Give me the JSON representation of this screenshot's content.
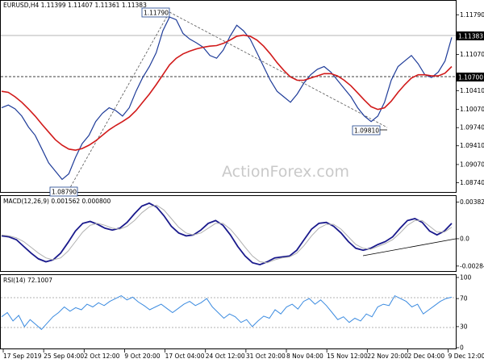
{
  "header": {
    "symbol_line": "EURUSD,H4  1.11399 1.11407 1.11361 1.11383",
    "macd_label": "MACD(12,26,9) 0.001562 0.000800",
    "rsi_label": "RSI(14) 72.1007",
    "watermark": "ActionForex.com"
  },
  "chart_data": [
    {
      "type": "line",
      "panel": "price",
      "y_ticks": [
        "1.11790",
        "1.11070",
        "1.10410",
        "1.10070",
        "1.09740",
        "1.09410",
        "1.09070",
        "1.08740"
      ],
      "y_range": [
        1.086,
        1.12
      ],
      "current_price": "1.11383",
      "horizontal_line_label": "1.10700",
      "annotations": [
        {
          "label": "1.11790",
          "value": 1.1179
        },
        {
          "label": "1.08790",
          "value": 1.0879
        },
        {
          "label": "1.09810",
          "value": 1.0981
        }
      ],
      "x_labels": [
        "17 Sep 2019",
        "25 Sep 04:00",
        "2 Oct 12:00",
        "9 Oct 20:00",
        "17 Oct 04:00",
        "24 Oct 12:00",
        "31 Oct 20:00",
        "8 Nov 04:00",
        "15 Nov 12:00",
        "22 Nov 20:00",
        "2 Dec 04:00",
        "9 Dec 12:00"
      ],
      "series": [
        {
          "name": "",
          "color": "#1f3c99",
          "values": [
            1.101,
            1.1015,
            1.1008,
            1.0995,
            1.0975,
            1.096,
            1.0935,
            1.091,
            1.0895,
            1.088,
            1.089,
            1.092,
            1.0945,
            1.096,
            1.0985,
            1.1,
            1.101,
            1.1005,
            1.0995,
            1.101,
            1.104,
            1.1065,
            1.1085,
            1.111,
            1.115,
            1.1175,
            1.117,
            1.1145,
            1.1135,
            1.1128,
            1.112,
            1.1105,
            1.11,
            1.1115,
            1.114,
            1.116,
            1.115,
            1.1135,
            1.111,
            1.1085,
            1.106,
            1.104,
            1.103,
            1.102,
            1.1035,
            1.1055,
            1.107,
            1.108,
            1.1085,
            1.1075,
            1.106,
            1.1045,
            1.103,
            1.101,
            1.0995,
            1.0985,
            1.0995,
            1.102,
            1.106,
            1.1085,
            1.1095,
            1.1105,
            1.109,
            1.107,
            1.1065,
            1.1075,
            1.1095,
            1.1138
          ]
        },
        {
          "name": "",
          "color": "#d11a1a",
          "values": [
            1.104,
            1.1038,
            1.103,
            1.102,
            1.1008,
            1.0995,
            1.098,
            1.0966,
            1.0952,
            1.0942,
            1.0935,
            1.0933,
            1.0936,
            1.0942,
            1.095,
            1.096,
            1.097,
            1.0978,
            1.0985,
            1.0993,
            1.1005,
            1.102,
            1.1035,
            1.1052,
            1.107,
            1.1088,
            1.11,
            1.1108,
            1.1113,
            1.1117,
            1.112,
            1.1122,
            1.1123,
            1.1127,
            1.1133,
            1.114,
            1.1142,
            1.114,
            1.1133,
            1.1122,
            1.1108,
            1.1092,
            1.1078,
            1.1066,
            1.106,
            1.106,
            1.1064,
            1.1068,
            1.1072,
            1.1072,
            1.1068,
            1.106,
            1.105,
            1.1037,
            1.1024,
            1.1012,
            1.1007,
            1.101,
            1.1022,
            1.1038,
            1.1052,
            1.1064,
            1.107,
            1.107,
            1.1068,
            1.1068,
            1.1073,
            1.1085
          ]
        }
      ]
    },
    {
      "type": "line",
      "panel": "macd",
      "y_ticks": [
        "0.003826",
        "0.0",
        "-0.002849"
      ],
      "y_range": [
        -0.0032,
        0.0042
      ],
      "series": [
        {
          "name": "",
          "color": "#1a1a8c",
          "values": [
            0.0003,
            0.0002,
            -0.0001,
            -0.0008,
            -0.0015,
            -0.0021,
            -0.0024,
            -0.0022,
            -0.0015,
            -0.0004,
            0.0008,
            0.0016,
            0.0018,
            0.0015,
            0.0011,
            0.0009,
            0.0011,
            0.0017,
            0.0026,
            0.0034,
            0.0037,
            0.0033,
            0.0024,
            0.0013,
            0.0006,
            0.0003,
            0.0004,
            0.0009,
            0.0016,
            0.0019,
            0.0014,
            0.0004,
            -0.0008,
            -0.0018,
            -0.0025,
            -0.0027,
            -0.0024,
            -0.002,
            -0.0019,
            -0.0018,
            -0.0012,
            -0.0001,
            0.001,
            0.0016,
            0.0017,
            0.0013,
            0.0006,
            -0.0003,
            -0.001,
            -0.0012,
            -0.001,
            -0.0006,
            -0.0003,
            0.0002,
            0.0011,
            0.0019,
            0.0021,
            0.0017,
            0.0008,
            0.0004,
            0.0008,
            0.0016
          ]
        },
        {
          "name": "",
          "color": "#b0b0b0",
          "values": [
            0.0004,
            0.0003,
            0.0001,
            -0.0003,
            -0.0009,
            -0.0015,
            -0.002,
            -0.0022,
            -0.002,
            -0.0013,
            -0.0003,
            0.0007,
            0.0014,
            0.0016,
            0.0014,
            0.0011,
            0.001,
            0.0013,
            0.0019,
            0.0027,
            0.0033,
            0.0035,
            0.003,
            0.0021,
            0.0012,
            0.0006,
            0.0004,
            0.0006,
            0.0011,
            0.0016,
            0.0016,
            0.001,
            0.0001,
            -0.0009,
            -0.0018,
            -0.0024,
            -0.0025,
            -0.0022,
            -0.002,
            -0.0019,
            -0.0015,
            -0.0007,
            0.0003,
            0.0011,
            0.0015,
            0.0015,
            0.001,
            0.0002,
            -0.0006,
            -0.001,
            -0.0011,
            -0.0008,
            -0.0005,
            -0.0001,
            0.0006,
            0.0014,
            0.0019,
            0.0019,
            0.0013,
            0.0007,
            0.0007,
            0.0012
          ]
        }
      ]
    },
    {
      "type": "line",
      "panel": "rsi",
      "y_ticks": [
        "100",
        "70",
        "30",
        "0"
      ],
      "y_range": [
        0,
        100
      ],
      "series": [
        {
          "name": "",
          "color": "#3b8be0",
          "values": [
            44,
            50,
            38,
            46,
            30,
            40,
            33,
            26,
            35,
            44,
            50,
            58,
            52,
            57,
            54,
            62,
            58,
            64,
            60,
            66,
            70,
            74,
            68,
            72,
            65,
            60,
            54,
            58,
            62,
            56,
            50,
            56,
            62,
            66,
            60,
            64,
            70,
            58,
            50,
            42,
            48,
            44,
            36,
            40,
            30,
            38,
            45,
            42,
            54,
            48,
            58,
            62,
            55,
            66,
            70,
            62,
            68,
            60,
            50,
            40,
            44,
            36,
            42,
            38,
            48,
            44,
            58,
            62,
            60,
            74,
            70,
            66,
            58,
            62,
            48,
            54,
            60,
            66,
            70,
            72
          ]
        }
      ]
    }
  ]
}
